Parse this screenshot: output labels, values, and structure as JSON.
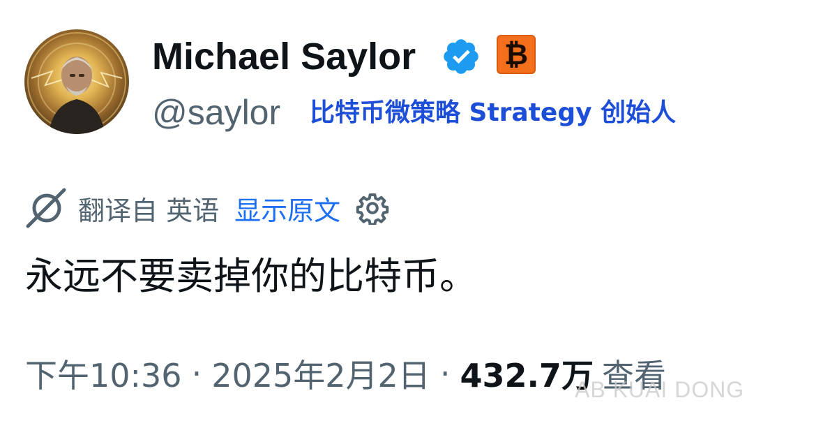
{
  "author": {
    "display_name": "Michael Saylor",
    "handle": "@saylor",
    "affiliation": "比特币微策略 Strategy 创始人",
    "verified_icon": "verified-badge-icon",
    "badge_glyph": "₿",
    "badge_icon": "bitcoin-badge-icon"
  },
  "translation": {
    "icon": "translate-icon",
    "translated_from": "翻译自 英语",
    "show_original": "显示原文",
    "settings_icon": "gear-icon"
  },
  "tweet": {
    "text": "永远不要卖掉你的比特币。"
  },
  "meta": {
    "time": "下午10:36",
    "separator": "·",
    "date": "2025年2月2日",
    "views_count": "432.7万",
    "views_label": "查看"
  },
  "watermark": "AB KUAI DONG",
  "colors": {
    "verified_blue": "#1d9bf0",
    "bitcoin_orange": "#f36f1c",
    "link_blue": "#1d6ff2",
    "affiliation_blue": "#1d4ed8",
    "secondary_text": "#536471",
    "primary_text": "#0f1419"
  }
}
